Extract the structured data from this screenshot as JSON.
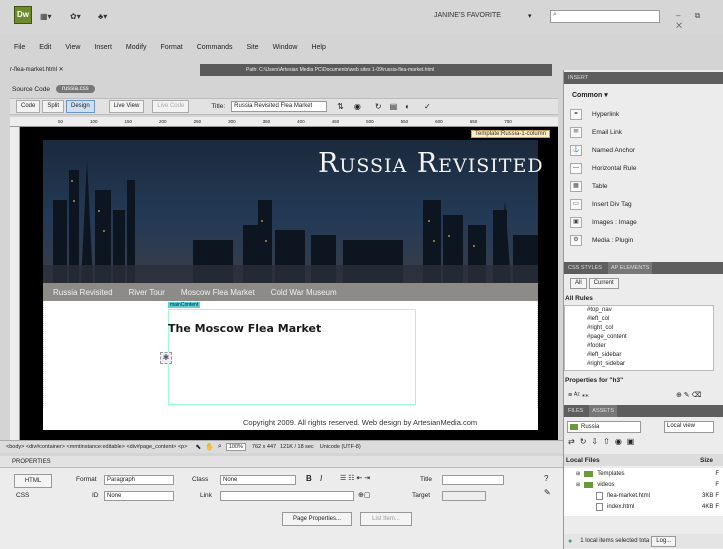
{
  "app": {
    "logo": "Dw",
    "workspace": "JANINE'S FAVORITE",
    "search_placeholder": "",
    "window_controls": "– ⧉ ✕"
  },
  "menu": [
    "File",
    "Edit",
    "View",
    "Insert",
    "Modify",
    "Format",
    "Commands",
    "Site",
    "Window",
    "Help"
  ],
  "doc": {
    "tab": "r-flea-market.html ✕",
    "path": "Path: C:\\Users\\Artesian Media PC\\Documents\\web sites 1-09\\russia-flea-market.html",
    "source_code": "Source Code",
    "source_file": "russia.css",
    "view_code": "Code",
    "view_split": "Split",
    "view_design": "Design",
    "live_view": "Live View",
    "live_code": "Live Code",
    "title_label": "Title:",
    "title_value": "Russia Revisited Flea Market"
  },
  "ruler_marks": [
    "50",
    "100",
    "150",
    "200",
    "250",
    "300",
    "350",
    "400",
    "450",
    "500",
    "550",
    "600",
    "650",
    "700"
  ],
  "canvas": {
    "template_tag": "Template:Russia-1-column",
    "banner_title": "Russia Revisited",
    "nav": [
      "Russia Revisited",
      "River Tour",
      "Moscow Flea Market",
      "Cold War Museum"
    ],
    "content_label": "mainContent",
    "heading": "The Moscow Flea Market",
    "copyright": "Copyright 2009. All rights reserved. Web design by ArtesianMedia.com"
  },
  "status": {
    "tags": "<body> <div#container> <mmtinstance:editable> <div#page_content> <p>",
    "zoom": "100%",
    "dims": "762 x 447",
    "size": "121K / 18 sec",
    "encoding": "Unicode (UTF-8)"
  },
  "properties": {
    "header": "PROPERTIES",
    "html_btn": "HTML",
    "css_btn": "CSS",
    "format_label": "Format",
    "format_value": "Paragraph",
    "class_label": "Class",
    "class_value": "None",
    "id_label": "ID",
    "id_value": "None",
    "link_label": "Link",
    "title_label": "Title",
    "target_label": "Target",
    "bold": "B",
    "italic": "I",
    "page_props": "Page Properties...",
    "list_item": "List Item..."
  },
  "insert_panel": {
    "header": "INSERT",
    "category": "Common",
    "items": [
      "Hyperlink",
      "Email Link",
      "Named Anchor",
      "Horizontal Rule",
      "Table",
      "Insert Div Tag",
      "Images : Image",
      "Media : Plugin"
    ]
  },
  "css_panel": {
    "tab1": "CSS STYLES",
    "tab2": "AP ELEMENTS",
    "all_btn": "All",
    "current_btn": "Current",
    "all_rules": "All Rules",
    "rules": [
      "#top_nav",
      "#left_col",
      "#right_col",
      "#page_content",
      "#footer",
      "#left_sidebar",
      "#right_sidebar"
    ],
    "properties_for": "Properties for \"h3\""
  },
  "files_panel": {
    "tab1": "FILES",
    "tab2": "ASSETS",
    "site": "Russia",
    "view": "Local view",
    "col_local": "Local Files",
    "col_size": "Size",
    "rows": [
      {
        "name": "Templates",
        "size": "",
        "type": "F"
      },
      {
        "name": "videos",
        "size": "",
        "type": "F"
      },
      {
        "name": "flea-market.html",
        "size": "3KB",
        "type": "F"
      },
      {
        "name": "index.html",
        "size": "4KB",
        "type": "F"
      }
    ],
    "status": "1 local items selected tota",
    "log_btn": "Log..."
  }
}
